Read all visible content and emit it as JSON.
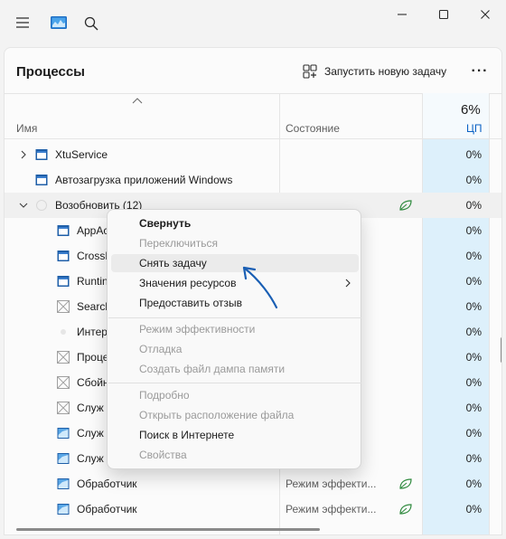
{
  "toolbar": {
    "page_title": "Процессы",
    "new_task_label": "Запустить новую задачу",
    "more_label": "···"
  },
  "columns": {
    "name": "Имя",
    "status": "Состояние",
    "cpu_percent": "6%",
    "cpu": "ЦП"
  },
  "rows": [
    {
      "name": "XtuService",
      "status": "",
      "cpu": "0%"
    },
    {
      "name": "Автозагрузка приложений Windows",
      "status": "",
      "cpu": "0%"
    },
    {
      "name": "Возобновить (12)",
      "status": "",
      "cpu": "0%"
    },
    {
      "name": "AppAc",
      "status": "",
      "cpu": "0%"
    },
    {
      "name": "CrossD",
      "status": "",
      "cpu": "0%"
    },
    {
      "name": "Runtin",
      "status": "",
      "cpu": "0%"
    },
    {
      "name": "Search",
      "status": "",
      "cpu": "0%"
    },
    {
      "name": "Интер",
      "status": "",
      "cpu": "0%"
    },
    {
      "name": "Проце",
      "status": "",
      "cpu": "0%"
    },
    {
      "name": "Сбойн",
      "status": "",
      "cpu": "0%"
    },
    {
      "name": "Служ",
      "status": "",
      "cpu": "0%"
    },
    {
      "name": "Служ",
      "status": "",
      "cpu": "0%"
    },
    {
      "name": "Служ",
      "status": "",
      "cpu": "0%"
    },
    {
      "name": "Обработчик",
      "status": "Режим эффекти...",
      "cpu": "0%"
    },
    {
      "name": "Обработчик",
      "status": "Режим эффекти...",
      "cpu": "0%"
    }
  ],
  "context_menu": {
    "items": [
      {
        "label": "Свернуть"
      },
      {
        "label": "Переключиться"
      },
      {
        "label": "Снять задачу"
      },
      {
        "label": "Значения ресурсов"
      },
      {
        "label": "Предоставить отзыв"
      },
      {
        "label": "Режим эффективности"
      },
      {
        "label": "Отладка"
      },
      {
        "label": "Создать файл дампа памяти"
      },
      {
        "label": "Подробно"
      },
      {
        "label": "Открыть расположение файла"
      },
      {
        "label": "Поиск в Интернете"
      },
      {
        "label": "Свойства"
      }
    ]
  },
  "colors": {
    "accent": "#0a61c4",
    "cpu_column": "#ddf0fb",
    "eco_leaf": "#2f8a3e",
    "annotation_arrow": "#1a5fb4"
  },
  "icons": [
    "menu-icon",
    "task-manager-icon",
    "search-icon",
    "minimize-icon",
    "maximize-icon",
    "close-icon",
    "new-task-icon",
    "more-icon",
    "chevron-right-icon",
    "chevron-down-icon",
    "app-window-icon",
    "placeholder-icon",
    "eco-leaf-icon",
    "submenu-arrow-icon"
  ]
}
